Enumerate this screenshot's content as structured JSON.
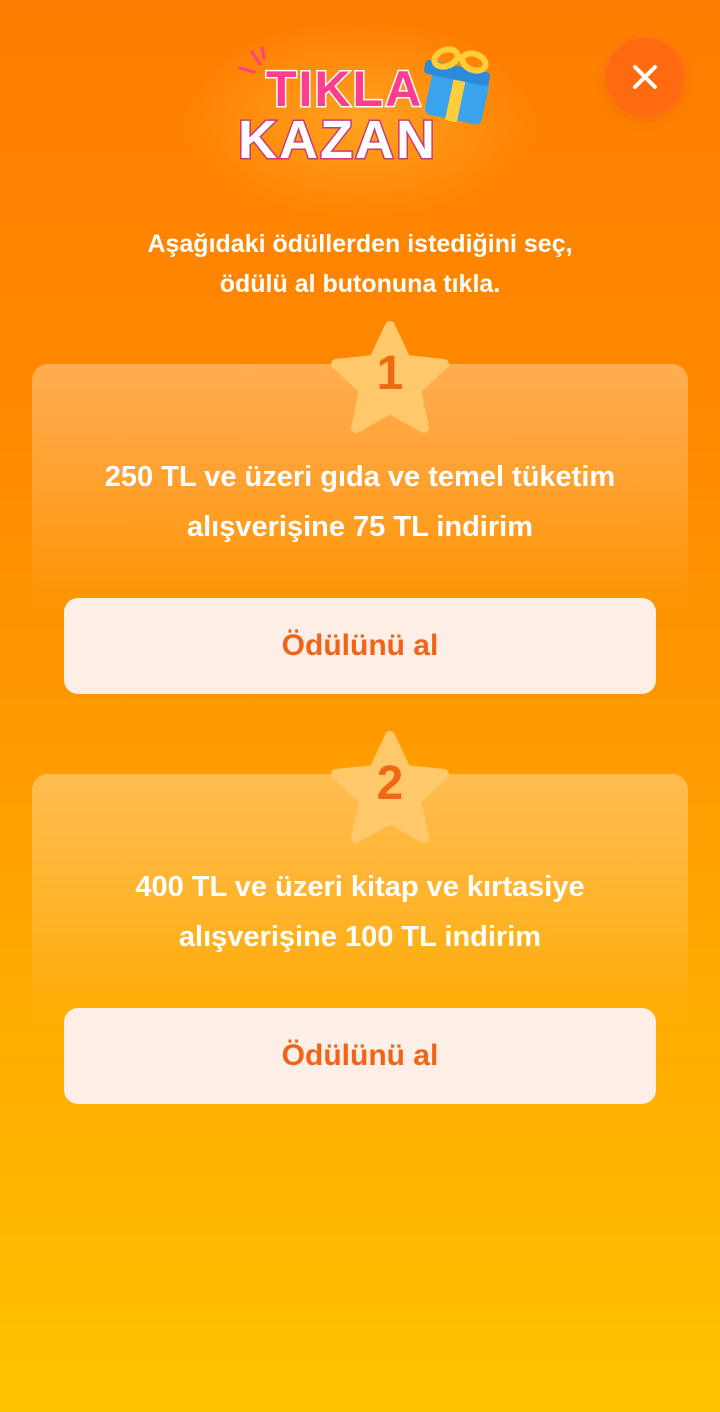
{
  "header": {
    "logo_line1": "TIKLA",
    "logo_line2": "KAZAN",
    "close_icon": "close-icon"
  },
  "intro": {
    "line1": "Aşağıdaki ödüllerden istediğini seç,",
    "line2": "ödülü al butonuna tıkla."
  },
  "rewards": [
    {
      "number": "1",
      "text_line1": "250 TL ve üzeri gıda ve temel tüketim",
      "text_line2": "alışverişine 75 TL indirim",
      "button_label": "Ödülünü al"
    },
    {
      "number": "2",
      "text_line1": "400 TL ve üzeri kitap ve kırtasiye",
      "text_line2": "alışverişine 100 TL indirim",
      "button_label": "Ödülünü al"
    }
  ],
  "colors": {
    "background_top": "#ff7d00",
    "background_bottom": "#ffc200",
    "accent": "#f0641a",
    "star": "#ffc96b",
    "button_bg": "#fdeee6"
  }
}
